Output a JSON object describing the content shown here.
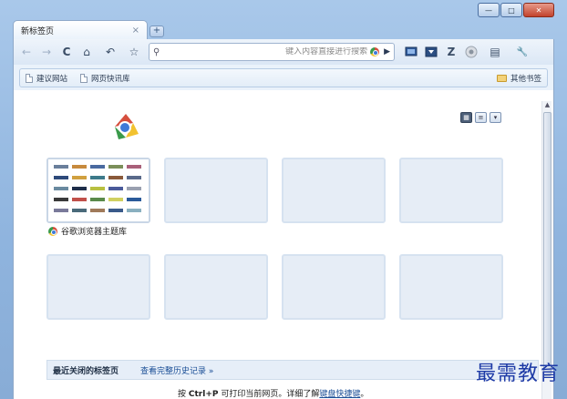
{
  "window": {
    "minimize": "—",
    "maximize": "□",
    "close": "✕"
  },
  "tab": {
    "title": "新标签页",
    "close": "×",
    "new_tab": "+"
  },
  "toolbar": {
    "back": "←",
    "forward": "→",
    "reload": "C",
    "home": "⌂",
    "undo": "↶",
    "star": "☆",
    "go": "▶",
    "z": "Z",
    "page_menu": "▤",
    "wrench": "🔧"
  },
  "omnibox": {
    "placeholder": "键入内容直接进行搜索",
    "value": ""
  },
  "bookmarks": {
    "items": [
      {
        "label": "建议网站"
      },
      {
        "label": "网页快讯库"
      }
    ],
    "other": "其他书签"
  },
  "thumbnails": {
    "first_label": "谷歌浏览器主题库"
  },
  "recent": {
    "title": "最近关闭的标签页",
    "history_link": "查看完整历史记录 »"
  },
  "tip": {
    "prefix": "按",
    "shortcut": "Ctrl+P",
    "middle": "可打印当前网页。详细了解",
    "link": "键盘快捷键",
    "suffix": "。"
  },
  "watermark": "最需教育",
  "colors": {
    "accent": "#1a4e96",
    "frame": "#a9c8ea"
  }
}
